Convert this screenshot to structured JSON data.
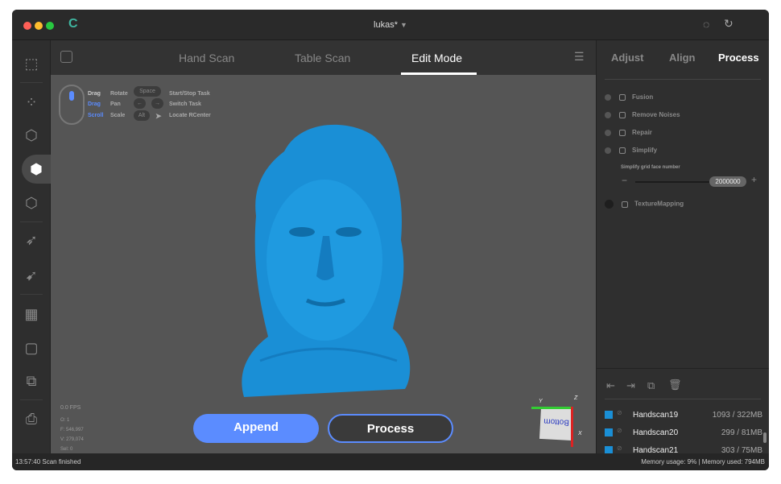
{
  "window": {
    "title": "lukas*"
  },
  "colors": {
    "accent": "#5b8cff",
    "model": "#1a8fd6",
    "background": "#555555"
  },
  "tabs": [
    {
      "label": "Hand Scan"
    },
    {
      "label": "Table Scan"
    },
    {
      "label": "Edit Mode",
      "active": true
    }
  ],
  "hints": {
    "drag1": "Drag",
    "rotate": "Rotate",
    "space": "Space",
    "start_stop": "Start/Stop Task",
    "drag2": "Drag",
    "pan": "Pan",
    "switch": "Switch Task",
    "scroll": "Scroll",
    "scale": "Scale",
    "alt": "Alt",
    "locate": "Locate RCenter"
  },
  "stats": {
    "fps": "0.0 FPS",
    "o": "O: 1",
    "f": "F: 546,997",
    "v": "V: 279,074",
    "sel": "Sel: 0"
  },
  "buttons": {
    "append": "Append",
    "process": "Process"
  },
  "gizmo": {
    "face": "Bottom",
    "y": "Y",
    "z": "Z",
    "x": "X"
  },
  "right_tabs": [
    {
      "label": "Adjust"
    },
    {
      "label": "Align"
    },
    {
      "label": "Process",
      "active": true
    }
  ],
  "process_steps": [
    {
      "label": "Fusion"
    },
    {
      "label": "Remove Noises"
    },
    {
      "label": "Repair"
    },
    {
      "label": "Simplify"
    }
  ],
  "simplify": {
    "label": "Simplify grid face number",
    "value": "2000000",
    "minus": "−",
    "plus": "+"
  },
  "texture": {
    "label": "TextureMapping"
  },
  "scans": [
    {
      "name": "Handscan19",
      "info": "1093 / 322MB"
    },
    {
      "name": "Handscan20",
      "info": "299 / 81MB"
    },
    {
      "name": "Handscan21",
      "info": "303 / 75MB"
    }
  ],
  "status": {
    "left": "13:57:40 Scan finished",
    "right": "Memory usage: 9% | Memory used: 794MB"
  }
}
